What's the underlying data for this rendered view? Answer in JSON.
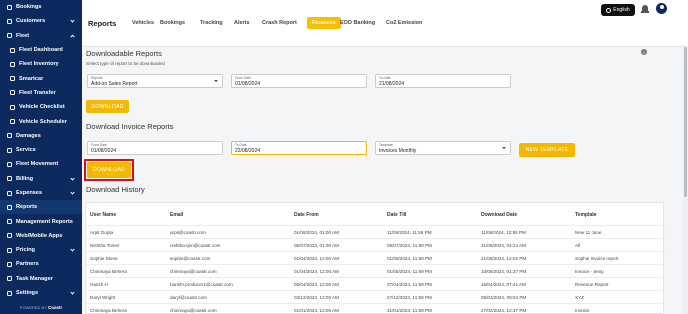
{
  "sidebar": {
    "items": [
      {
        "label": "Bookings",
        "icon": "calendar-icon",
        "chevron": false,
        "sub": false
      },
      {
        "label": "Customers",
        "icon": "users-icon",
        "chevron": "down",
        "sub": false
      },
      {
        "label": "Fleet",
        "icon": "car-icon",
        "chevron": "up",
        "sub": false
      },
      {
        "label": "Fleet Dashboard",
        "icon": "dashboard-icon",
        "chevron": false,
        "sub": true
      },
      {
        "label": "Fleet Inventory",
        "icon": "inventory-icon",
        "chevron": false,
        "sub": true
      },
      {
        "label": "Smartcar",
        "icon": "smartcar-icon",
        "chevron": false,
        "sub": true
      },
      {
        "label": "Fleet Transfer",
        "icon": "transfer-icon",
        "chevron": false,
        "sub": true
      },
      {
        "label": "Vehicle Checklist",
        "icon": "checklist-icon",
        "chevron": false,
        "sub": true
      },
      {
        "label": "Vehicle Scheduler",
        "icon": "scheduler-icon",
        "chevron": false,
        "sub": true
      },
      {
        "label": "Damages",
        "icon": "warning-icon",
        "chevron": false,
        "sub": false
      },
      {
        "label": "Service",
        "icon": "wrench-icon",
        "chevron": false,
        "sub": false
      },
      {
        "label": "Fleet Movement",
        "icon": "movement-icon",
        "chevron": false,
        "sub": false
      },
      {
        "label": "Billing",
        "icon": "billing-icon",
        "chevron": "down",
        "sub": false
      },
      {
        "label": "Expenses",
        "icon": "expenses-icon",
        "chevron": "down",
        "sub": false
      },
      {
        "label": "Reports",
        "icon": "reports-icon",
        "chevron": false,
        "sub": false,
        "active": true
      },
      {
        "label": "Management Reports",
        "icon": "chart-icon",
        "chevron": false,
        "sub": false
      },
      {
        "label": "Web/Mobile Apps",
        "icon": "mobile-icon",
        "chevron": false,
        "sub": false
      },
      {
        "label": "Pricing",
        "icon": "pricing-icon",
        "chevron": "down",
        "sub": false
      },
      {
        "label": "Partners",
        "icon": "partners-icon",
        "chevron": false,
        "sub": false
      },
      {
        "label": "Task Manager",
        "icon": "tasks-icon",
        "chevron": false,
        "sub": false
      },
      {
        "label": "Settings",
        "icon": "gear-icon",
        "chevron": "down",
        "sub": false
      }
    ],
    "powered_by": "POWERED BY",
    "powered_brand": "Coastr"
  },
  "header": {
    "title": "Reports",
    "tabs": [
      "Vehicles",
      "Bookings",
      "Tracking",
      "Alerts",
      "Crash Report",
      "Finances",
      "EOD Banking",
      "Co2 Emission"
    ],
    "active_tab": "Finances",
    "language": "English"
  },
  "downloadable": {
    "title": "Downloadable Reports",
    "subtitle": "Select type of report to be downloaded",
    "report_label": "Reports",
    "report_value": "Add-on Sales Report",
    "from_label": "From Date",
    "from_value": "01/08/2024",
    "to_label": "To Date",
    "to_value": "21/08/2024",
    "download_label": "DOWNLOAD"
  },
  "invoice": {
    "title": "Download Invoice Reports",
    "from_label": "From Date",
    "from_value": "01/08/2024",
    "to_label": "To Date",
    "to_value": "22/08/2024",
    "template_label": "Template",
    "template_value": "Invoices Monthly",
    "new_template_label": "NEW TEMPLATE",
    "download_label": "DOWNLOAD"
  },
  "history": {
    "title": "Download History",
    "columns": [
      "User Name",
      "Email",
      "Date From",
      "Date Till",
      "Download Date",
      "Template"
    ],
    "rows": [
      [
        "Arpit Gupta",
        "arpit@coastr.com",
        "01/06/2024, 01:00 AM",
        "11/06/2024, 11:59 PM",
        "11/06/2024, 12:55 PM",
        "New 11 June"
      ],
      [
        "Nishtha Tomer",
        "nishtha+jen@coastr.com",
        "05/07/2023, 01:00 AM",
        "09/07/2023, 11:59 PM",
        "31/05/2024, 04:24 AM",
        "All"
      ],
      [
        "Sophie Stone",
        "sophie@coastr.com",
        "01/04/2024, 12:00 AM",
        "01/05/2024, 11:59 PM",
        "21/05/2024, 12:02 PM",
        "Sophie Invoice report"
      ],
      [
        "Chinmaya Behera",
        "chinmaya@coastr.com",
        "01/04/2024, 12:00 AM",
        "01/05/2024, 11:59 PM",
        "10/05/2024, 01:37 PM",
        "Invoice - temp"
      ],
      [
        "Harish H",
        "harish+producer1@coastr.com",
        "05/04/2024, 12:00 AM",
        "07/04/2024, 11:59 PM",
        "16/04/2024, 07:41 AM",
        "Revenue Report"
      ],
      [
        "Daryl Wright",
        "daryl@coastr.com",
        "03/12/2023, 12:00 AM",
        "27/12/2023, 11:59 PM",
        "08/03/2024, 09:04 PM",
        "XYZ"
      ],
      [
        "Chinmaya Behera",
        "chinmaya@coastr.com",
        "01/01/2024, 12:00 AM",
        "31/01/2024, 11:59 PM",
        "27/02/2024, 12:37 PM",
        "Invoice"
      ]
    ]
  },
  "colors": {
    "sidebar_bg": "#0c2a5e",
    "accent": "#f5b800",
    "highlight_outline": "#d3121e"
  }
}
